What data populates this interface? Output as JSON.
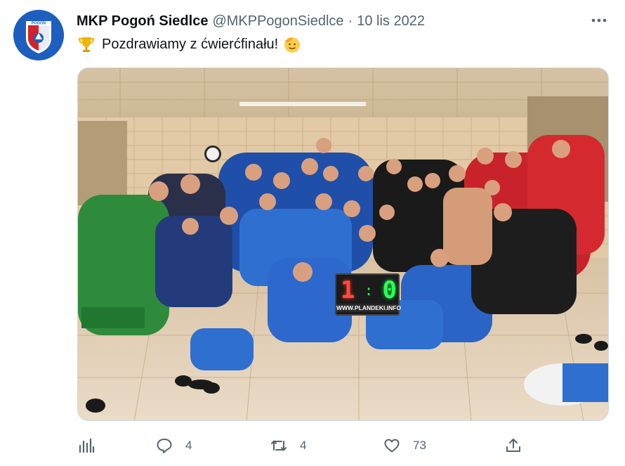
{
  "tweet": {
    "author": {
      "display_name": "MKP Pogoń Siedlce",
      "handle": "@MKPPogonSiedlce",
      "avatar_text": "POGOŃ"
    },
    "separator": "·",
    "date": "10 lis 2022",
    "text": "Pozdrawiamy z ćwierćfinału!",
    "emoji_before": "trophy-emoji",
    "emoji_after": "saluting-face-emoji",
    "media": {
      "scoreboard": {
        "home": "1",
        "separator": ":",
        "away": "0",
        "url": "WWW.PLANDEKI.INFO"
      }
    },
    "actions": {
      "analytics": {
        "icon": "analytics-icon"
      },
      "reply": {
        "icon": "reply-icon",
        "count": "4"
      },
      "retweet": {
        "icon": "retweet-icon",
        "count": "4"
      },
      "like": {
        "icon": "like-icon",
        "count": "73"
      },
      "share": {
        "icon": "share-icon"
      }
    }
  },
  "colors": {
    "primary_text": "#0f1419",
    "secondary_text": "#536471",
    "border": "#cfd9de",
    "club_blue": "#1d5fbf",
    "club_red": "#d2232a"
  }
}
